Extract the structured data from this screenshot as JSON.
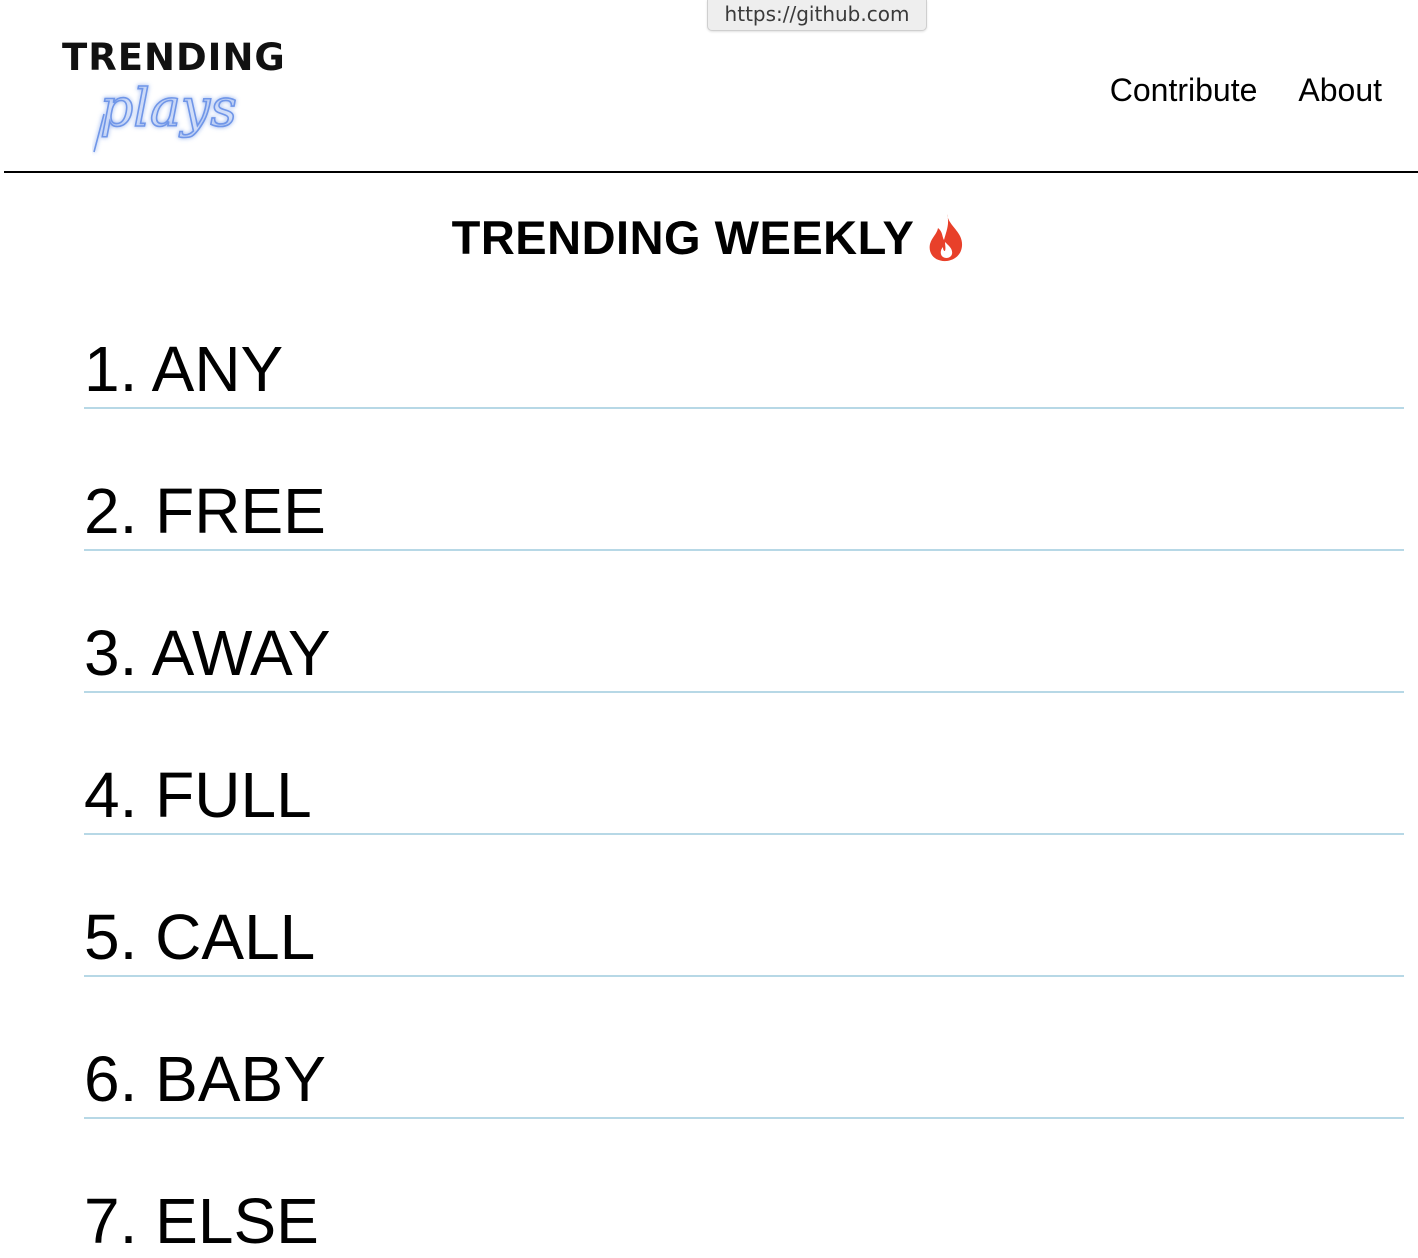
{
  "tooltip": {
    "url": "https://github.com"
  },
  "header": {
    "logo": {
      "word": "TRENDING",
      "script": "plays"
    },
    "nav": [
      {
        "label": "Contribute"
      },
      {
        "label": "About"
      }
    ]
  },
  "main": {
    "title": "TRENDING WEEKLY",
    "title_icon": "fire-icon",
    "items": [
      {
        "rank": "1.",
        "word": "ANY"
      },
      {
        "rank": "2.",
        "word": "FREE"
      },
      {
        "rank": "3.",
        "word": "AWAY"
      },
      {
        "rank": "4.",
        "word": "FULL"
      },
      {
        "rank": "5.",
        "word": "CALL"
      },
      {
        "rank": "6.",
        "word": "BABY"
      },
      {
        "rank": "7.",
        "word": "ELSE"
      }
    ]
  },
  "colors": {
    "divider": "#b7d8e6",
    "logo_script": "#6f96e8",
    "fire": "#e8402a"
  }
}
